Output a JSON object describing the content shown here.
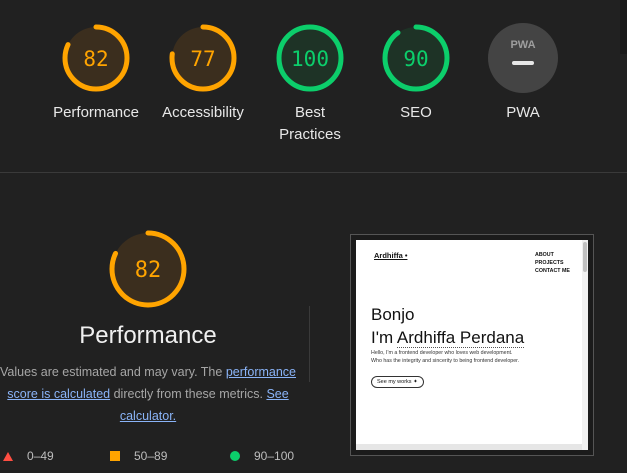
{
  "gauges": [
    {
      "score": "82",
      "label": "Performance",
      "kind": "average",
      "fraction": 0.82
    },
    {
      "score": "77",
      "label": "Accessibility",
      "kind": "average",
      "fraction": 0.77
    },
    {
      "score": "100",
      "label": "Best Practices",
      "kind": "pass",
      "fraction": 1.0
    },
    {
      "score": "90",
      "label": "SEO",
      "kind": "pass",
      "fraction": 0.9
    },
    {
      "score": "PWA",
      "label": "PWA",
      "kind": "pwa",
      "fraction": 0
    }
  ],
  "colors": {
    "average": "#ffa400",
    "average_fill": "#3b2e1e",
    "pass": "#0cce6b",
    "pass_fill": "#1e3326",
    "fail": "#ff4e42",
    "pwa_fill": "#444444"
  },
  "performance": {
    "score": "82",
    "fraction": 0.82,
    "title": "Performance",
    "desc_prefix": "Values are estimated and may vary. The",
    "score_link": "performance score is calculated",
    "desc_middle": "directly from these metrics.",
    "calc_link": "See calculator."
  },
  "legend": {
    "fail": "0–49",
    "average": "50–89",
    "pass": "90–100"
  },
  "screenshot": {
    "brand": "Ardhiffa •",
    "nav": [
      "ABOUT",
      "PROJECTS",
      "CONTACT ME"
    ],
    "line1": "Bonjo",
    "line2_prefix": "I'm ",
    "line2_name": "Ardhiffa Perdana",
    "sub1": "Hello, I'm a frontend developer who loves web development.",
    "sub2": "Who has the integrity and sincerity to being frontend developer.",
    "button": "See my works ✦"
  }
}
